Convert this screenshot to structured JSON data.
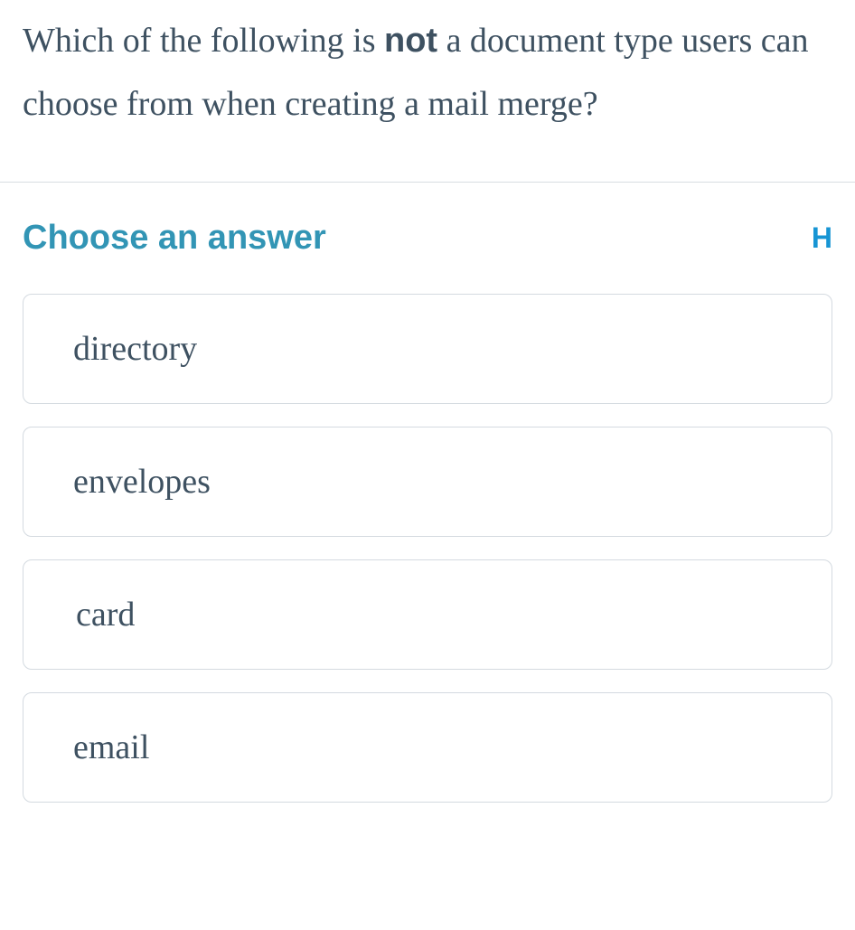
{
  "question": {
    "prefix": "Which of the following is ",
    "bold": "not",
    "suffix": " a document type users can choose from when creating a mail merge?"
  },
  "answer_section": {
    "header": "Choose an answer",
    "help": "H"
  },
  "options": [
    {
      "label": "directory"
    },
    {
      "label": "envelopes"
    },
    {
      "label": "card"
    },
    {
      "label": "email"
    }
  ]
}
